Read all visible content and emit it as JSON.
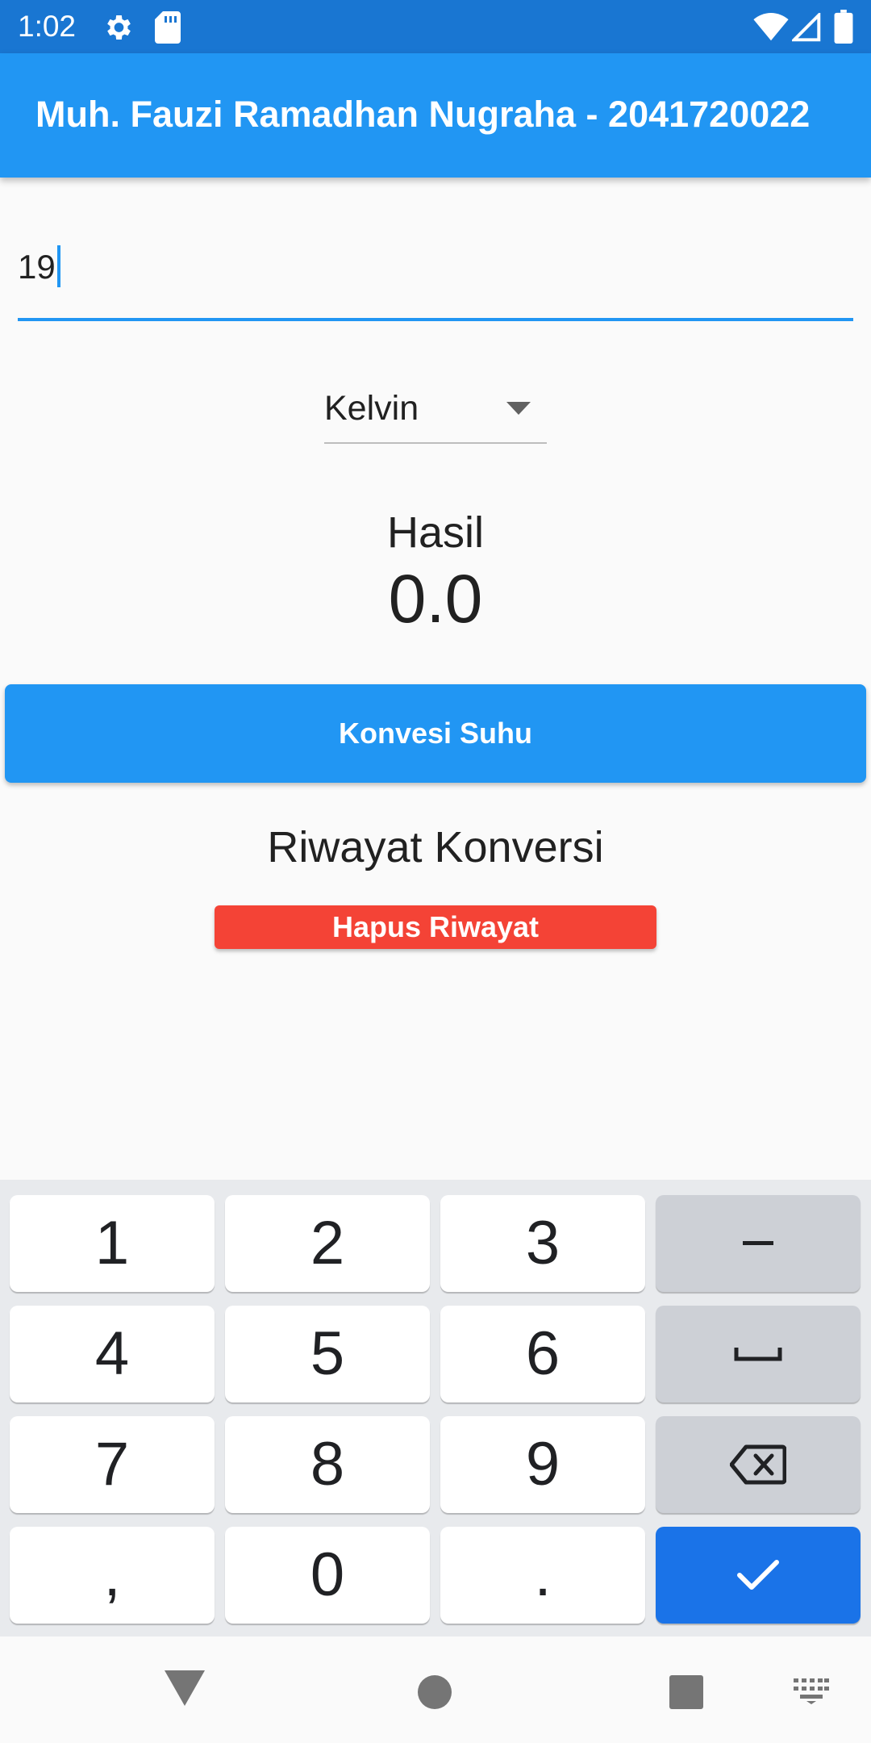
{
  "status_bar": {
    "time": "1:02",
    "icons": [
      "gear-icon",
      "sd-card-icon",
      "wifi-icon",
      "signal-icon",
      "battery-icon"
    ]
  },
  "app_bar": {
    "title": "Muh. Fauzi Ramadhan Nugraha - 2041720022"
  },
  "input": {
    "value": "19"
  },
  "dropdown": {
    "selected": "Kelvin"
  },
  "result": {
    "label": "Hasil",
    "value": "0.0"
  },
  "convert_button": {
    "label": "Konvesi Suhu"
  },
  "history": {
    "title": "Riwayat Konversi",
    "clear_label": "Hapus Riwayat"
  },
  "keyboard": {
    "keys": [
      "1",
      "2",
      "3",
      "−",
      "4",
      "5",
      "6",
      "␣",
      "7",
      "8",
      "9",
      "⌫",
      ",",
      "0",
      ".",
      "✓"
    ],
    "icons": [
      "space-icon",
      "backspace-icon",
      "check-icon"
    ]
  },
  "nav_bar": {
    "icons": [
      "back-icon",
      "home-icon",
      "recents-icon",
      "keyboard-switch-icon"
    ]
  },
  "colors": {
    "status_bar": "#1976d2",
    "primary": "#2196f3",
    "danger": "#f44336",
    "keyboard_bg": "#e8eaed",
    "enter_key": "#1a73e8"
  }
}
